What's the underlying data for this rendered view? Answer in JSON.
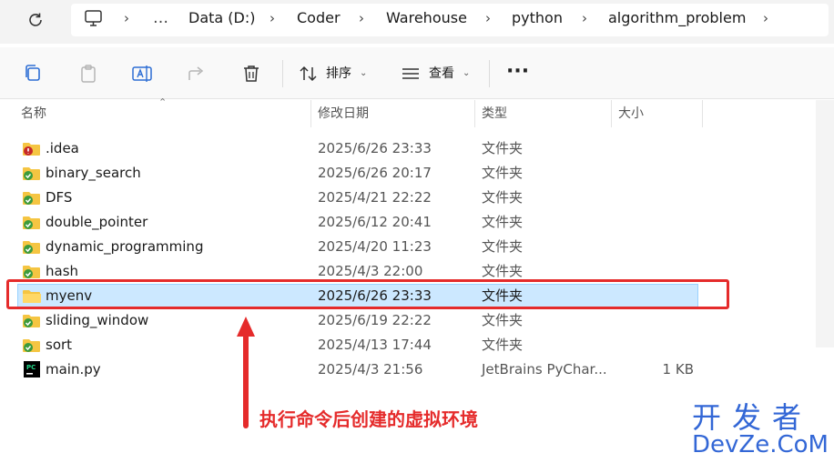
{
  "breadcrumbs": [
    "Data (D:)",
    "Coder",
    "Warehouse",
    "python",
    "algorithm_problem"
  ],
  "toolbar": {
    "sort_label": "排序",
    "view_label": "查看"
  },
  "columns": {
    "name": "名称",
    "date": "修改日期",
    "type": "类型",
    "size": "大小"
  },
  "files": [
    {
      "name": ".idea",
      "date": "2025/6/26 23:33",
      "type": "文件夹",
      "size": "",
      "icon": "folder-error-icon"
    },
    {
      "name": "binary_search",
      "date": "2025/6/26 20:17",
      "type": "文件夹",
      "size": "",
      "icon": "folder-synced-icon"
    },
    {
      "name": "DFS",
      "date": "2025/4/21 22:22",
      "type": "文件夹",
      "size": "",
      "icon": "folder-synced-icon"
    },
    {
      "name": "double_pointer",
      "date": "2025/6/12 20:41",
      "type": "文件夹",
      "size": "",
      "icon": "folder-synced-icon"
    },
    {
      "name": "dynamic_programming",
      "date": "2025/4/20 11:23",
      "type": "文件夹",
      "size": "",
      "icon": "folder-synced-icon"
    },
    {
      "name": "hash",
      "date": "2025/4/3 22:00",
      "type": "文件夹",
      "size": "",
      "icon": "folder-synced-icon"
    },
    {
      "name": "myenv",
      "date": "2025/6/26 23:33",
      "type": "文件夹",
      "size": "",
      "icon": "folder-icon",
      "selected": true
    },
    {
      "name": "sliding_window",
      "date": "2025/6/19 22:22",
      "type": "文件夹",
      "size": "",
      "icon": "folder-synced-icon"
    },
    {
      "name": "sort",
      "date": "2025/4/13 17:44",
      "type": "文件夹",
      "size": "",
      "icon": "folder-synced-icon"
    },
    {
      "name": "main.py",
      "date": "2025/4/3 21:56",
      "type": "JetBrains PyChar...",
      "size": "1 KB",
      "icon": "pycharm-file-icon"
    }
  ],
  "annotation": "执行命令后创建的虚拟环境",
  "watermark": {
    "line1": "开发者",
    "line2": "DevZe.CoM"
  },
  "colors": {
    "accent": "#e52b2b",
    "selection": "#cce8ff",
    "watermark": "#3367d6"
  }
}
